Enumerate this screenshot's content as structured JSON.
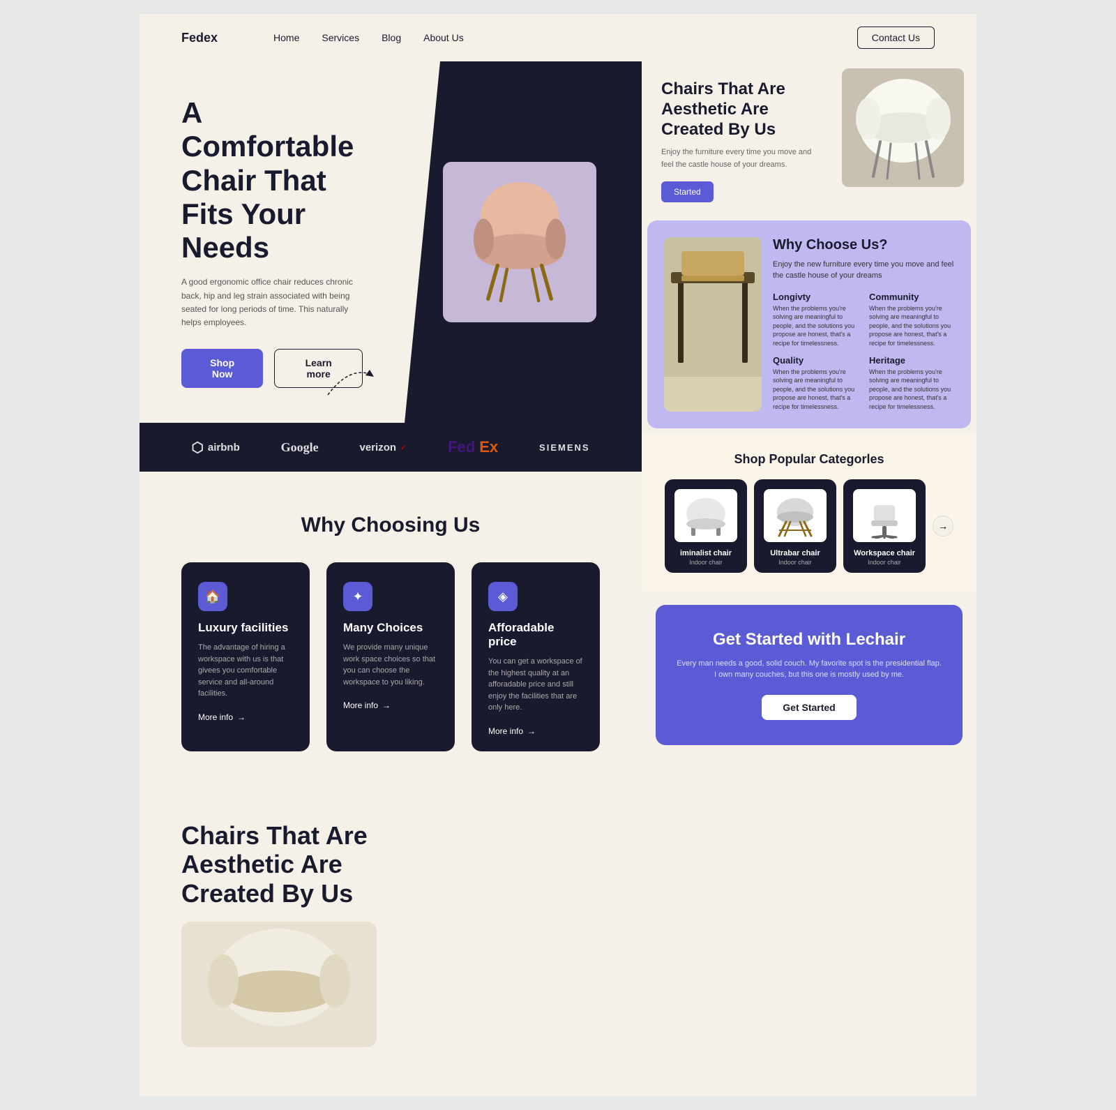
{
  "brand": "Fedex",
  "nav": {
    "links": [
      "Home",
      "Services",
      "Blog",
      "About Us"
    ],
    "cta": "Contact Us"
  },
  "hero": {
    "title": "A Comfortable Chair That Fits Your Needs",
    "description": "A good ergonomic office chair reduces chronic back, hip and leg strain associated with being seated for long periods of time. This naturally helps employees.",
    "shop_btn": "Shop Now",
    "learn_btn": "Learn more"
  },
  "brands": [
    "airbnb",
    "Google",
    "verizon✓",
    "FedEx",
    "SIEMENS"
  ],
  "why_choosing": {
    "title": "Why Choosing Us",
    "cards": [
      {
        "icon": "🏠",
        "title": "Luxury facilities",
        "desc": "The advantage of hiring a workspace with us is that givees you comfortable service and all-around facilities.",
        "more": "More info"
      },
      {
        "icon": "✦",
        "title": "Many Choices",
        "desc": "We provide many unique work space choices so that you can choose the workspace to you liking.",
        "more": "More info"
      },
      {
        "icon": "💎",
        "title": "Afforadable price",
        "desc": "You can get a workspace of the highest quality at an afforadable price and still enjoy the facilities that are only here.",
        "more": "More info"
      }
    ]
  },
  "right_hero": {
    "title": "Chairs That Are Aesthetic Are Created By Us",
    "description": "Enjoy the furniture every time you move and feel the castle house of your dreams.",
    "button": "Started"
  },
  "why_choose": {
    "title": "Why Choose Us?",
    "description": "Enjoy the new furniture every time you move and feel the castle house of your dreams",
    "features": [
      {
        "title": "Longivty",
        "desc": "When the problems you're solving are meaningful to people, and the solutions you propose are honest, that's a recipe for timelessness."
      },
      {
        "title": "Community",
        "desc": "When the problems you're solving are meaningful to people, and the solutions you propose are honest, that's a recipe for timelessness."
      },
      {
        "title": "Quality",
        "desc": "When the problems you're solving are meaningful to people, and the solutions you propose are honest, that's a recipe for timelessness."
      },
      {
        "title": "Heritage",
        "desc": "When the problems you're solving are meaningful to people, and the solutions you propose are honest, that's a recipe for timelessness."
      }
    ]
  },
  "shop": {
    "title": "Shop Popular Categorles",
    "items": [
      {
        "name": "iminalist chair",
        "sub": "Indoor chair"
      },
      {
        "name": "Ultrabar chair",
        "sub": "Indoor chair"
      },
      {
        "name": "Workspace chair",
        "sub": "Indoor chair"
      }
    ]
  },
  "bottom": {
    "title": "Chairs That Are Aesthetic Are Created By Us"
  },
  "get_started": {
    "title": "Get Started with Lechair",
    "description": "Every man needs a good, solid couch. My favorite spot is the presidential flap. I own many couches, but this one is mostly used by me.",
    "button": "Get Started"
  }
}
